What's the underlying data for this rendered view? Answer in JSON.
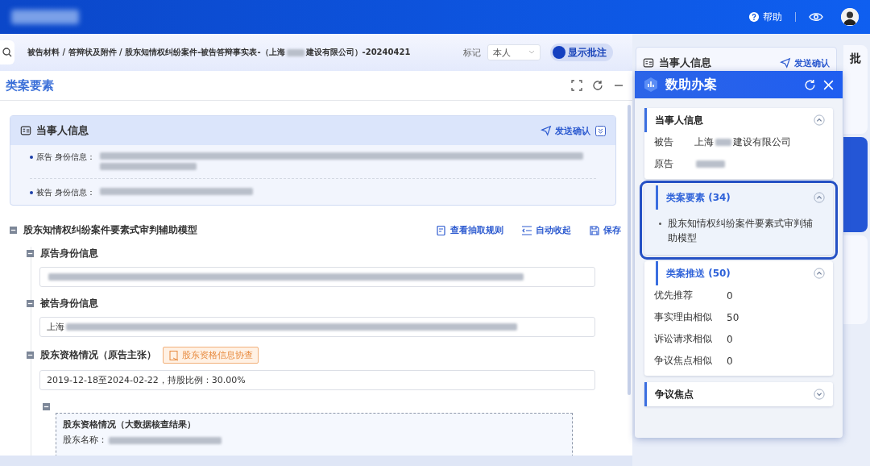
{
  "header": {
    "help": "帮助"
  },
  "toolbar": {
    "breadcrumb_prefix": "被告材料 / 答辩状及附件 / 股东知情权纠纷案件-被告答辩事实表-（上海",
    "breadcrumb_suffix": "建设有限公司）-20240421",
    "mark_label": "标记",
    "mark_value": "本人",
    "annotation_toggle": {
      "label": "显示批注",
      "on": true
    }
  },
  "back_card": {
    "title": "当事人信息",
    "action": "发送确认"
  },
  "side_tabs": [
    {
      "label": "批",
      "selected": false
    },
    {
      "selected": true
    },
    {
      "selected": false
    }
  ],
  "panel": {
    "title": "类案要素",
    "parties_card": {
      "title": "当事人信息",
      "action": "发送确认",
      "expanded": true,
      "rows": [
        {
          "role": "原告",
          "label": "身份信息：",
          "kind": "long"
        },
        {
          "role": "被告",
          "label": "身份信息：",
          "kind": "short"
        }
      ]
    },
    "model": {
      "title": "股东知情权纠纷案件要素式审判辅助模型",
      "actions": [
        {
          "kind": "rules",
          "label": "查看抽取规则"
        },
        {
          "kind": "collapse",
          "label": "自动收起"
        },
        {
          "kind": "save",
          "label": "保存"
        }
      ],
      "fields": [
        {
          "label": "原告身份信息",
          "redacted": true
        },
        {
          "label": "被告身份信息",
          "value": "上海",
          "redacted": true
        },
        {
          "label": "股东资格情况（原告主张）",
          "tag": "股东资格信息协查",
          "value": "2019-12-18至2024-02-22，持股比例：30.00%",
          "redacted": false
        }
      ],
      "result": {
        "title": "股东资格情况（大数据核查结果）",
        "label": "股东名称：",
        "redacted": true
      }
    }
  },
  "assistant": {
    "title": "数助办案",
    "sections": [
      {
        "kind": "pairs",
        "title": "当事人信息",
        "active": false,
        "highlighted": false,
        "expanded": true,
        "rows": [
          {
            "key": "被告",
            "value": "上海",
            "redacted": true,
            "suffix": "建设有限公司"
          },
          {
            "key": "原告",
            "redacted": true
          }
        ]
      },
      {
        "kind": "list",
        "title": "类案要素 (34)",
        "active": true,
        "highlighted": true,
        "expanded": true,
        "items": [
          "股东知情权纠纷案件要素式审判辅助模型"
        ]
      },
      {
        "kind": "pairs",
        "title": "类案推送 (50)",
        "active": true,
        "highlighted": false,
        "expanded": true,
        "rows": [
          {
            "key": "优先推荐",
            "value": "0",
            "redacted": false
          },
          {
            "key": "事实理由相似",
            "value": "50",
            "redacted": false
          },
          {
            "key": "诉讼请求相似",
            "value": "0",
            "redacted": false
          },
          {
            "key": "争议焦点相似",
            "value": "0",
            "redacted": false
          }
        ]
      },
      {
        "title": "争议焦点",
        "active": false,
        "highlighted": false,
        "expanded": false
      }
    ]
  }
}
